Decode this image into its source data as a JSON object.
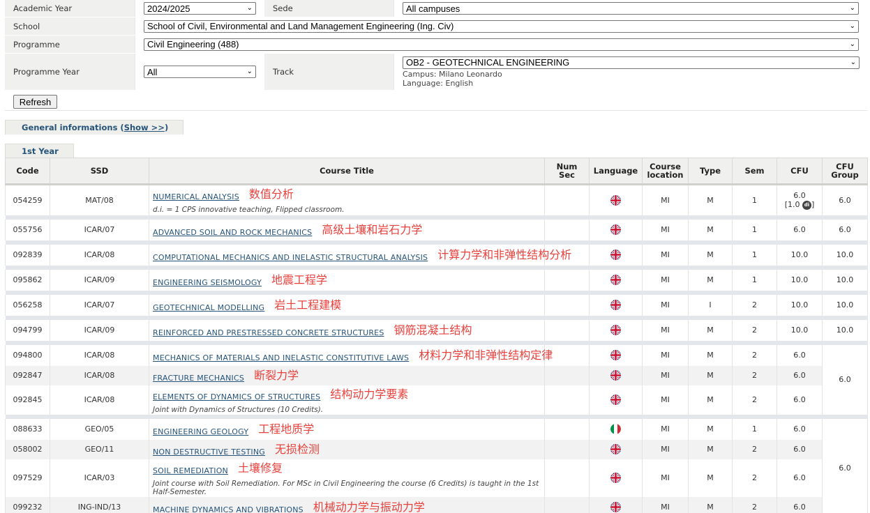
{
  "filters": {
    "academic_year_label": "Academic Year",
    "academic_year_value": "2024/2025",
    "sede_label": "Sede",
    "sede_value": "All campuses",
    "school_label": "School",
    "school_value": "School of Civil, Environmental and Land Management Engineering (Ing. Civ)",
    "programme_label": "Programme",
    "programme_value": "Civil Engineering (488)",
    "programme_year_label": "Programme Year",
    "programme_year_value": "All",
    "track_label": "Track",
    "track_value": "OB2 - GEOTECHNICAL ENGINEERING",
    "track_campus": "Campus: Milano Leonardo",
    "track_language": "Language: English",
    "refresh_label": "Refresh"
  },
  "tabs": {
    "general_label": "General informations (",
    "general_link": "Show >>",
    "general_close": ")",
    "year_label": "1st Year"
  },
  "table": {
    "headers": {
      "code": "Code",
      "ssd": "SSD",
      "title": "Course Title",
      "num_sec_1": "Num",
      "num_sec_2": "Sec",
      "language": "Language",
      "location_1": "Course",
      "location_2": "location",
      "type": "Type",
      "sem": "Sem",
      "cfu": "CFU",
      "cfu_group_1": "CFU",
      "cfu_group_2": "Group"
    },
    "rows": [
      {
        "code": "054259",
        "ssd": "MAT/08",
        "title": "NUMERICAL ANALYSIS",
        "note": "d.i. = 1 CPS innovative teaching, Flipped classroom.",
        "zh": "数值分析",
        "lang": "uk",
        "loc": "MI",
        "type": "M",
        "sem": "1",
        "cfu": "6.0",
        "cfu_extra": "[1.0",
        "cfu_extra_icon": "di",
        "cfu_extra_close": "]",
        "group": "6.0"
      },
      {
        "code": "055756",
        "ssd": "ICAR/07",
        "title": "ADVANCED SOIL AND ROCK MECHANICS",
        "zh": "高级土壤和岩石力学",
        "lang": "uk",
        "loc": "MI",
        "type": "M",
        "sem": "1",
        "cfu": "6.0",
        "group": "6.0"
      },
      {
        "code": "092839",
        "ssd": "ICAR/08",
        "title": "COMPUTATIONAL MECHANICS AND INELASTIC STRUCTURAL ANALYSIS",
        "zh": "计算力学和非弹性结构分析",
        "lang": "uk",
        "loc": "MI",
        "type": "M",
        "sem": "1",
        "cfu": "10.0",
        "group": "10.0"
      },
      {
        "code": "095862",
        "ssd": "ICAR/09",
        "title": "ENGINEERING SEISMOLOGY",
        "zh": "地震工程学",
        "lang": "uk",
        "loc": "MI",
        "type": "M",
        "sem": "1",
        "cfu": "10.0",
        "group": "10.0"
      },
      {
        "code": "056258",
        "ssd": "ICAR/07",
        "title": "GEOTECHNICAL MODELLING",
        "zh": "岩土工程建模",
        "lang": "uk",
        "loc": "MI",
        "type": "I",
        "sem": "2",
        "cfu": "10.0",
        "group": "10.0"
      },
      {
        "code": "094799",
        "ssd": "ICAR/09",
        "title": "REINFORCED AND PRESTRESSED CONCRETE STRUCTURES",
        "zh": "钢筋混凝土结构",
        "lang": "uk",
        "loc": "MI",
        "type": "M",
        "sem": "2",
        "cfu": "10.0",
        "group": "10.0"
      },
      {
        "code": "094800",
        "ssd": "ICAR/08",
        "title": "MECHANICS OF MATERIALS AND INELASTIC CONSTITUTIVE LAWS",
        "zh": "材料力学和非弹性结构定律",
        "lang": "uk",
        "loc": "MI",
        "type": "M",
        "sem": "2",
        "cfu": "6.0"
      },
      {
        "code": "092847",
        "ssd": "ICAR/08",
        "title": "FRACTURE MECHANICS",
        "zh": "断裂力学",
        "lang": "uk",
        "loc": "MI",
        "type": "M",
        "sem": "2",
        "cfu": "6.0"
      },
      {
        "code": "092845",
        "ssd": "ICAR/08",
        "title": "ELEMENTS OF DYNAMICS OF STRUCTURES",
        "note": "Joint with Dynamics of Structures (10 Credits).",
        "zh": "结构动力学要素",
        "lang": "uk",
        "loc": "MI",
        "type": "M",
        "sem": "2",
        "cfu": "6.0"
      },
      {
        "code": "088633",
        "ssd": "GEO/05",
        "title": "ENGINEERING GEOLOGY",
        "zh": "工程地质学",
        "lang": "it",
        "loc": "MI",
        "type": "M",
        "sem": "1",
        "cfu": "6.0"
      },
      {
        "code": "058002",
        "ssd": "GEO/11",
        "title": "NON DESTRUCTIVE TESTING",
        "zh": "无损检测",
        "lang": "uk",
        "loc": "MI",
        "type": "M",
        "sem": "2",
        "cfu": "6.0"
      },
      {
        "code": "097529",
        "ssd": "ICAR/03",
        "title": "SOIL REMEDIATION",
        "note": "Joint course with Soil Remediation. For MSc in Civil Engineering the course (6 Credits) is taught in the 1st Half-Semester.",
        "zh": "土壤修复",
        "lang": "uk",
        "loc": "MI",
        "type": "M",
        "sem": "2",
        "cfu": "6.0"
      },
      {
        "code": "099232",
        "ssd": "ING-IND/13",
        "title": "MACHINE DYNAMICS AND VIBRATIONS",
        "zh": "机械动力学与振动力学",
        "lang": "uk",
        "loc": "MI",
        "type": "M",
        "sem": "2",
        "cfu": "6.0"
      }
    ],
    "group_a": "6.0",
    "group_b": "6.0"
  }
}
